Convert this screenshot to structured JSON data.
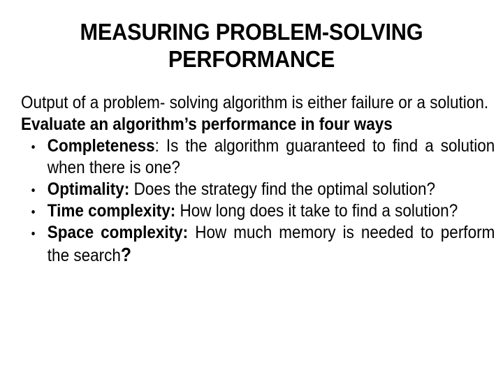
{
  "slide": {
    "background_color": "#ffffff",
    "text_color": "#000000",
    "title": "MEASURING PROBLEM-SOLVING\nPERFORMANCE",
    "paragraphs": [
      {
        "id": "intro",
        "text": "Output of a problem- solving algorithm is either failure or a solution.",
        "bold": false
      },
      {
        "id": "lead-in",
        "text": "Evaluate an algorithm’s performance in four ways",
        "bold": true
      }
    ],
    "bullets": [
      {
        "term": "Completeness",
        "separator": ":",
        "separator_bold": false,
        "text": " Is the algorithm guaranteed to find a solution when there is one?",
        "trailing_bold_mark": ""
      },
      {
        "term": "Optimality",
        "separator": ":",
        "separator_bold": true,
        "text": " Does the strategy find the optimal solution?",
        "trailing_bold_mark": ""
      },
      {
        "term": "Time complexity",
        "separator": ":",
        "separator_bold": true,
        "text": " How long does it take to find a solution?",
        "trailing_bold_mark": ""
      },
      {
        "term": "Space complexity",
        "separator": ":",
        "separator_bold": true,
        "text": " How much memory is needed to perform the search",
        "trailing_bold_mark": "?"
      }
    ]
  }
}
